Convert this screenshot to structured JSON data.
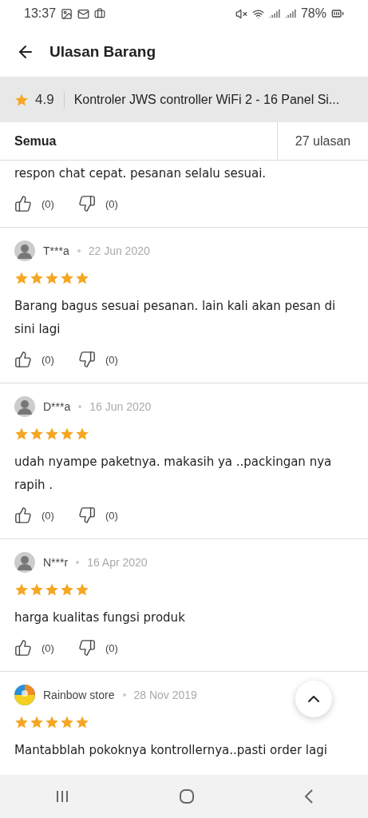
{
  "status_bar": {
    "time": "13:37",
    "battery": "78%"
  },
  "header": {
    "title": "Ulasan Barang"
  },
  "product": {
    "rating": "4.9",
    "name": "Kontroler JWS controller WiFi  2 - 16 Panel Si..."
  },
  "tabs": [
    {
      "label": "Semua",
      "selected": true
    }
  ],
  "review_count": "27 ulasan",
  "reviews": [
    {
      "kind": "partial",
      "text": "respon chat cepat. pesanan selalu sesuai.",
      "likes": "(0)",
      "dislikes": "(0)"
    },
    {
      "kind": "person",
      "author": "T***a",
      "date": "22 Jun 2020",
      "stars": 5,
      "text": "Barang bagus sesuai pesanan. lain kali akan pesan di sini lagi",
      "likes": "(0)",
      "dislikes": "(0)"
    },
    {
      "kind": "person",
      "author": "D***a",
      "date": "16 Jun 2020",
      "stars": 5,
      "text": "udah nyampe paketnya. makasih ya ..packingan nya rapih .",
      "likes": "(0)",
      "dislikes": "(0)"
    },
    {
      "kind": "person",
      "author": "N***r",
      "date": "16 Apr 2020",
      "stars": 5,
      "text": "harga kualitas fungsi produk",
      "likes": "(0)",
      "dislikes": "(0)"
    },
    {
      "kind": "store",
      "author": "Rainbow store",
      "date": "28 Nov 2019",
      "stars": 5,
      "text": "Mantabblah pokoknya kontrollernya..pasti order lagi"
    }
  ]
}
